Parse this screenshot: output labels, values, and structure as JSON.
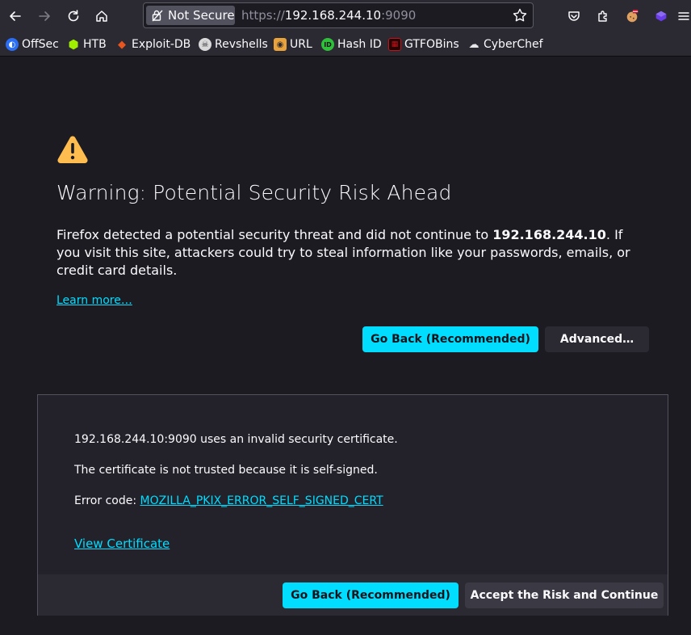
{
  "toolbar": {
    "security_label": "Not Secure",
    "url_scheme": "https://",
    "url_host": "192.168.244.10",
    "url_port": ":9090"
  },
  "bookmarks": [
    {
      "label": "OffSec",
      "icon": "offsec-icon",
      "color": "#2a6ef5"
    },
    {
      "label": "HTB",
      "icon": "htb-icon",
      "color": "#9fef00"
    },
    {
      "label": "Exploit-DB",
      "icon": "exploitdb-icon",
      "color": "#e9551f"
    },
    {
      "label": "Revshells",
      "icon": "skull-icon",
      "color": "#d9d9d9"
    },
    {
      "label": "URL",
      "icon": "url-icon",
      "color": "#e8a33d"
    },
    {
      "label": "Hash ID",
      "icon": "hashid-icon",
      "color": "#2fbf3a"
    },
    {
      "label": "GTFOBins",
      "icon": "gtfobins-icon",
      "color": "#c0141c"
    },
    {
      "label": "CyberChef",
      "icon": "cyberchef-icon",
      "color": "#e6e6e6"
    }
  ],
  "page": {
    "title": "Warning: Potential Security Risk Ahead",
    "desc_before": "Firefox detected a potential security threat and did not continue to ",
    "desc_host": "192.168.244.10",
    "desc_after": ". If you visit this site, attackers could try to steal information like your passwords, emails, or credit card details.",
    "learn_more": "Learn more…",
    "go_back_label": "Go Back (Recommended)",
    "advanced_label": "Advanced…"
  },
  "advanced": {
    "line1": "192.168.244.10:9090 uses an invalid security certificate.",
    "line2": "The certificate is not trusted because it is self-signed.",
    "error_prefix": "Error code: ",
    "error_code": "MOZILLA_PKIX_ERROR_SELF_SIGNED_CERT",
    "view_certificate": "View Certificate",
    "go_back_label": "Go Back (Recommended)",
    "accept_label": "Accept the Risk and Continue"
  },
  "colors": {
    "accent": "#00ddff",
    "warning": "#ffbd4f",
    "background": "#1c1b22"
  }
}
